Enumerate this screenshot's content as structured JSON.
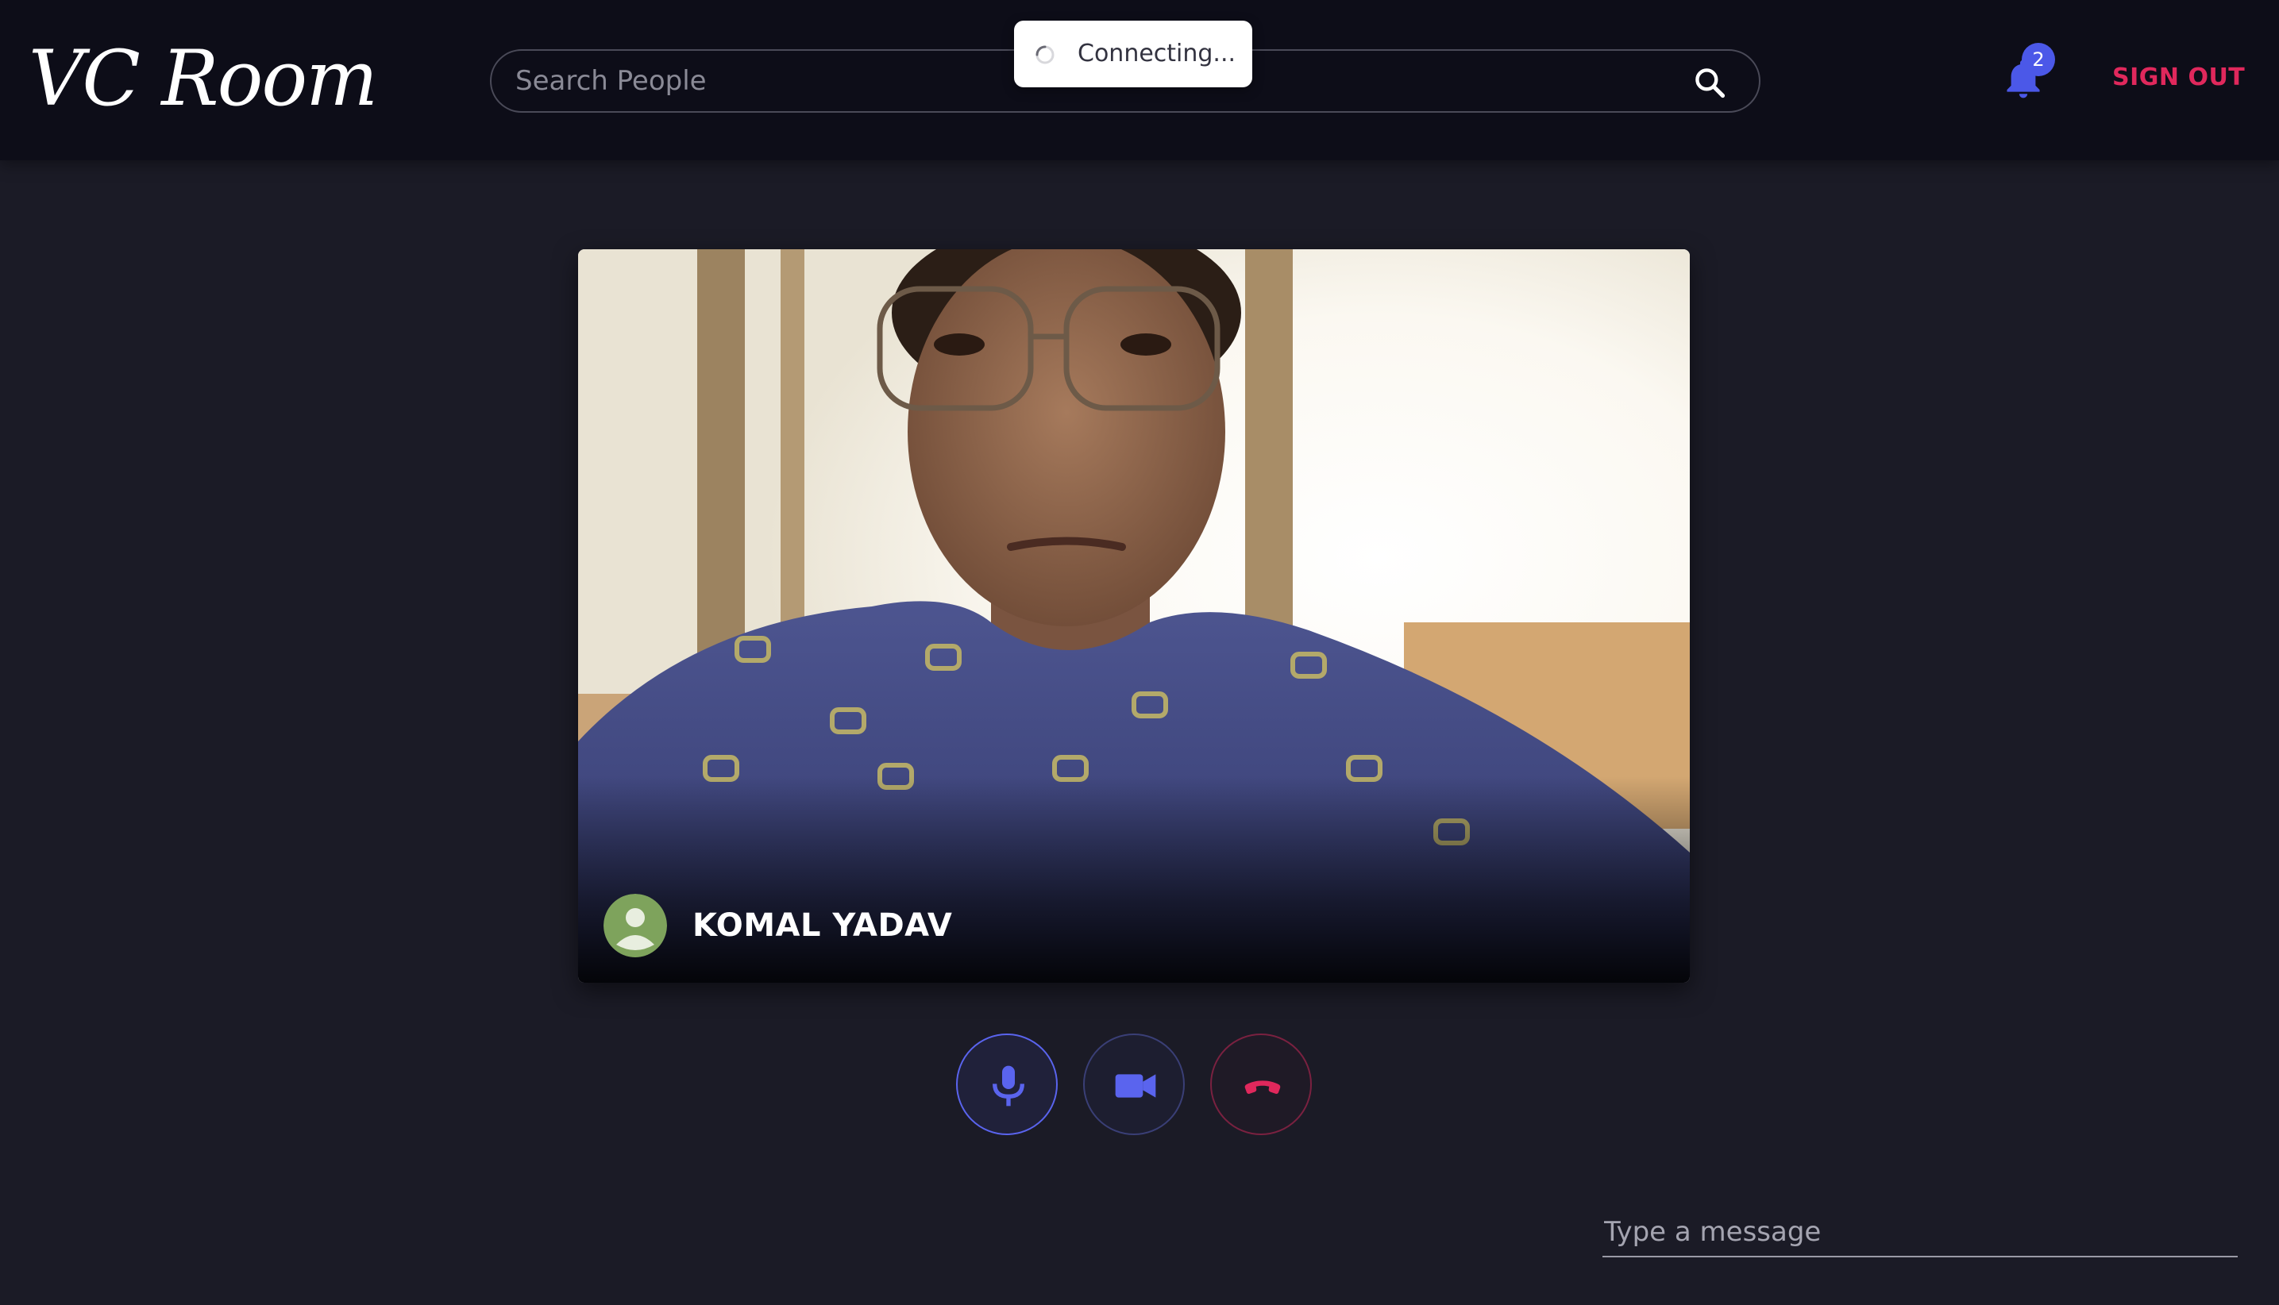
{
  "app": {
    "logo_text": "VC Room"
  },
  "header": {
    "search": {
      "placeholder": "Search People",
      "value": ""
    },
    "notifications": {
      "count": "2"
    },
    "sign_out_label": "SIGN OUT"
  },
  "toast": {
    "text": "Connecting..."
  },
  "video": {
    "participant_name": "KOMAL YADAV"
  },
  "controls": {
    "mic_icon": "microphone-icon",
    "camera_icon": "video-camera-icon",
    "end_call_icon": "hang-up-icon"
  },
  "chat": {
    "placeholder": "Type a message",
    "value": ""
  },
  "colors": {
    "background": "#1b1b26",
    "header": "#0d0d18",
    "accent": "#4b58e8",
    "danger": "#e0285c"
  }
}
